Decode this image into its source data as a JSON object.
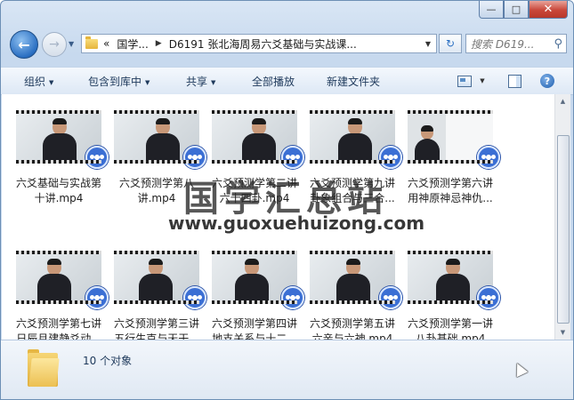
{
  "window": {
    "buttons": {
      "minimize": "—",
      "maximize": "□",
      "close": "✕"
    }
  },
  "nav": {
    "back": "←",
    "forward": "→",
    "address": {
      "lead": "«",
      "segments": [
        "国学...",
        "D6191 张北海周易六爻基础与实战课..."
      ]
    },
    "search_placeholder": "搜索 D619..."
  },
  "toolbar": {
    "organize": "组织",
    "include_in_library": "包含到库中",
    "share": "共享",
    "play_all": "全部播放",
    "new_folder": "新建文件夹"
  },
  "files": [
    {
      "line1": "六爻基础与实战第",
      "line2": "十讲.mp4"
    },
    {
      "line1": "六爻预测学第八",
      "line2": "讲.mp4"
    },
    {
      "line1": "六爻预测学第二讲",
      "line2": "六十四卦.mp4"
    },
    {
      "line1": "六爻预测学第九讲",
      "line2": "卦象组合与三合..."
    },
    {
      "line1": "六爻预测学第六讲",
      "line2": "用神原神忌神仇..."
    },
    {
      "line1": "六爻预测学第七讲",
      "line2": "日辰月建静爻动..."
    },
    {
      "line1": "六爻预测学第三讲",
      "line2": "五行生克与天干..."
    },
    {
      "line1": "六爻预测学第四讲",
      "line2": "地支关系与十二..."
    },
    {
      "line1": "六爻预测学第五讲",
      "line2": "六亲与六神.mp4"
    },
    {
      "line1": "六爻预测学第一讲",
      "line2": "八卦基础.mp4"
    }
  ],
  "watermark": {
    "title": "国学汇总站",
    "url": "www.guoxuehuizong.com"
  },
  "status": {
    "count": "10 个对象"
  },
  "colors": {
    "accent": "#2a6fc2",
    "toolbar_text": "#1e395b"
  }
}
